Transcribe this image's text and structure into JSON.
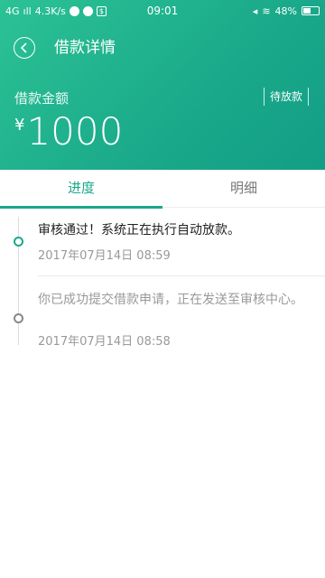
{
  "status_bar": {
    "network": "4G",
    "speed": "4.3K/s",
    "time": "09:01",
    "battery": "48%"
  },
  "header": {
    "title": "借款详情",
    "amount_label": "借款金额",
    "currency": "¥",
    "amount": "1000",
    "status_tag": "待放款"
  },
  "tabs": [
    {
      "label": "进度",
      "active": true
    },
    {
      "label": "明细",
      "active": false
    }
  ],
  "timeline": [
    {
      "text": "审核通过！系统正在执行自动放款。",
      "date": "2017年07月14日 08:59",
      "active": true
    },
    {
      "text": "你已成功提交借款申请，正在发送至审核中心。",
      "date": "2017年07月14日 08:58",
      "active": false
    }
  ],
  "colors": {
    "accent": "#1aa98a",
    "header_start": "#2cc295"
  }
}
